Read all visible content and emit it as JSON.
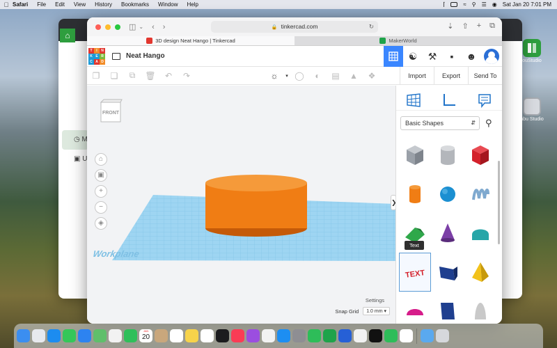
{
  "menubar": {
    "app_name": "Safari",
    "menus": [
      "File",
      "Edit",
      "View",
      "History",
      "Bookmarks",
      "Window",
      "Help"
    ],
    "clock": "Sat Jan 20  7:01 PM"
  },
  "desktop": {
    "icons": [
      {
        "label": "ouStudio",
        "color": "#2e9e3e"
      },
      {
        "label": "nbu Studio",
        "color": "#d7dadf"
      }
    ]
  },
  "back_window": {
    "sidebar_items": [
      {
        "label": "M",
        "icon": "clock-icon"
      },
      {
        "label": "U",
        "icon": "document-icon"
      }
    ]
  },
  "browser": {
    "url": "tinkercad.com",
    "tabs": [
      {
        "title": "3D design Neat Hango | Tinkercad",
        "active": true
      },
      {
        "title": "MakerWorld",
        "active": false
      }
    ]
  },
  "tinkercad": {
    "logo_letters": [
      "T",
      "I",
      "N",
      "K",
      "E",
      "R",
      "C",
      "A",
      "D"
    ],
    "logo_colors": [
      "#e2372f",
      "#f28c28",
      "#e2372f",
      "#1d9bd7",
      "#1d9bd7",
      "#7cbb3d",
      "#1d9bd7",
      "#e2372f",
      "#f28c28"
    ],
    "project_name": "Neat Hango",
    "actions": {
      "import": "Import",
      "export": "Export",
      "send_to": "Send To"
    },
    "viewcube_face": "FRONT",
    "workplane_label": "Workplane",
    "settings_label": "Settings",
    "snap_grid_label": "Snap Grid",
    "snap_grid_value": "1.0 mm",
    "library": "Basic Shapes",
    "tooltip": "Text",
    "shape_color": "#f07d14",
    "accent_color": "#3a86ff",
    "shapes": [
      {
        "name": "box-striped",
        "color": "#9aa0a8"
      },
      {
        "name": "cylinder-striped",
        "color": "#b3b6bb"
      },
      {
        "name": "box",
        "color": "#d4212b"
      },
      {
        "name": "cylinder",
        "color": "#f07d14"
      },
      {
        "name": "sphere",
        "color": "#1b8fd1"
      },
      {
        "name": "scribble",
        "color": "#7fa9cf"
      },
      {
        "name": "roof",
        "color": "#2fa84a"
      },
      {
        "name": "cone",
        "color": "#7b3fa6"
      },
      {
        "name": "round-roof",
        "color": "#27a6a8"
      },
      {
        "name": "text",
        "color": "#d4212b"
      },
      {
        "name": "wedge",
        "color": "#1f3f8f"
      },
      {
        "name": "pyramid",
        "color": "#f2c21b"
      },
      {
        "name": "half-sphere",
        "color": "#d61d8a"
      },
      {
        "name": "box-tall",
        "color": "#1f3f8f"
      },
      {
        "name": "paraboloid",
        "color": "#c9c9c9"
      }
    ]
  },
  "dock": {
    "calendar_month": "JAN",
    "calendar_day": "20",
    "icons": [
      "finder",
      "launchpad",
      "safari",
      "messages",
      "mail",
      "maps",
      "photos",
      "facetime",
      "calendar",
      "contacts",
      "reminders",
      "notes",
      "freeform",
      "appletv",
      "music",
      "podcasts",
      "news",
      "appstore",
      "settings",
      "numbers",
      "bambu",
      "cura",
      "chrome",
      "capcut",
      "numbers2",
      "tinkercad",
      "sep",
      "downloads",
      "trash"
    ]
  }
}
